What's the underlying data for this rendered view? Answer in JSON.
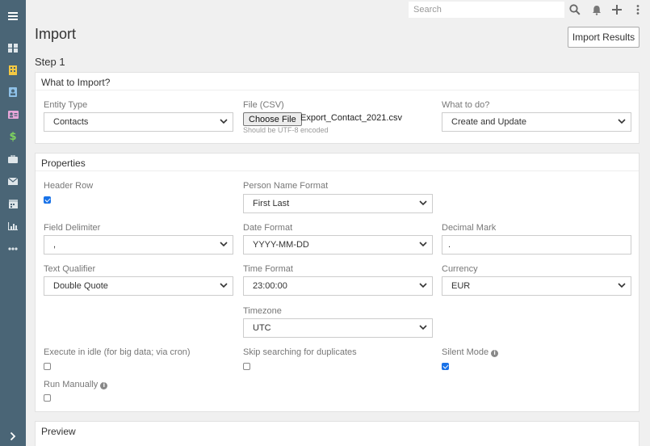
{
  "header": {
    "search_placeholder": "Search",
    "page_title": "Import",
    "import_results_label": "Import Results",
    "step_label": "Step 1"
  },
  "what_to_import": {
    "title": "What to Import?",
    "entity_type": {
      "label": "Entity Type",
      "value": "Contacts"
    },
    "file": {
      "label": "File (CSV)",
      "button": "Choose File",
      "file_name": "Export_Contact_2021.csv",
      "hint": "Should be UTF-8 encoded"
    },
    "what_to_do": {
      "label": "What to do?",
      "value": "Create and Update"
    }
  },
  "properties": {
    "title": "Properties",
    "header_row": {
      "label": "Header Row",
      "checked": true
    },
    "person_name_format": {
      "label": "Person Name Format",
      "value": "First Last"
    },
    "field_delimiter": {
      "label": "Field Delimiter",
      "value": ","
    },
    "date_format": {
      "label": "Date Format",
      "value": "YYYY-MM-DD"
    },
    "decimal_mark": {
      "label": "Decimal Mark",
      "value": "."
    },
    "text_qualifier": {
      "label": "Text Qualifier",
      "value": "Double Quote"
    },
    "time_format": {
      "label": "Time Format",
      "value": "23:00:00"
    },
    "currency": {
      "label": "Currency",
      "value": "EUR"
    },
    "timezone": {
      "label": "Timezone",
      "value": "UTC"
    },
    "execute_in_idle": {
      "label": "Execute in idle (for big data; via cron)",
      "checked": false
    },
    "skip_duplicates": {
      "label": "Skip searching for duplicates",
      "checked": false
    },
    "silent_mode": {
      "label": "Silent Mode",
      "checked": true
    },
    "run_manually": {
      "label": "Run Manually",
      "checked": false
    }
  },
  "preview": {
    "title": "Preview"
  },
  "sidebar": {
    "items": [
      "menu-icon",
      "dashboard-icon",
      "building-icon",
      "contact-book-icon",
      "id-card-icon",
      "dollar-icon",
      "briefcase-icon",
      "envelope-icon",
      "calendar-icon",
      "report-icon",
      "more-icon",
      "expand-icon"
    ]
  },
  "colors": {
    "sidebar": "#4a6576",
    "accent": "#1a73e8",
    "background": "#f0f0f0"
  }
}
